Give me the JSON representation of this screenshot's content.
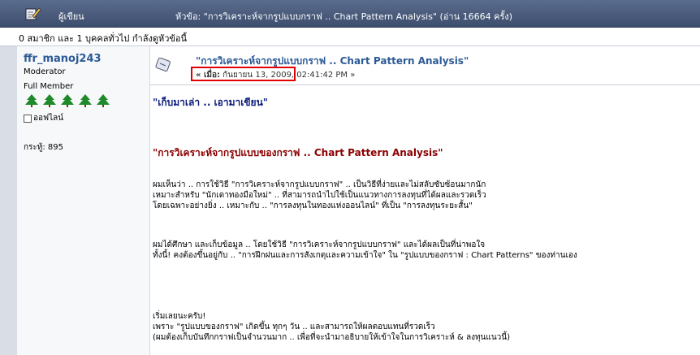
{
  "header": {
    "author_column": "ผู้เขียน",
    "topic": "หัวข้อ: \"การวิเคราะห์จากรูปแบบกราฟ .. Chart Pattern Analysis\"  (อ่าน 16664 ครั้ง)",
    "icon": "edit-icon"
  },
  "viewers": {
    "text": "0 สมาชิก และ 1 บุคคลทั่วไป กำลังดูหัวข้อนี้"
  },
  "poster": {
    "name": "ffr_manoj243",
    "role": "Moderator",
    "rank": "Full Member",
    "stars_icon": "tree-icon",
    "star_count": 5,
    "status": "ออฟไลน์",
    "posts": "กระทู้: 895"
  },
  "post": {
    "icon": "post-icon",
    "title": "\"การวิเคราะห์จากรูปแบบกราฟ .. Chart Pattern Analysis\"",
    "date_prefix": "« เมื่อ:",
    "date": "กันยายน 13, 2009, 02:41:42 PM »",
    "quote": "\"เก็บมาเล่า .. เอามาเขียน\"",
    "heading": "\"การวิเคราะห์จากรูปแบบของกราฟ .. Chart Pattern Analysis\"",
    "paragraphs": [
      [
        "ผมเห็นว่า .. การใช้วิธี \"การวิเคราะห์จากรูปแบบกราฟ\" .. เป็นวิธีที่ง่ายและไม่สลับซับซ้อนมากนัก",
        "เหมาะสำหรับ \"นักเดาทองมือใหม่\" .. ที่สามารถนำไปใช้เป็นแนวทางการลงทุนที่ได้ผลและรวดเร็ว",
        "โดยเฉพาะอย่างยิ่ง .. เหมาะกับ .. \"การลงทุนในทองแห่งออนไลน์\" ที่เป็น \"การลงทุนระยะสั้น\""
      ],
      [
        "ผมได้ศึกษา และเก็บข้อมูล .. โดยใช้วิธี \"การวิเคราะห์จากรูปแบบกราฟ\" และได้ผลเป็นที่น่าพอใจ",
        "ทั้งนี้!  คงต้องขึ้นอยู่กับ .. \"การฝึกฝนและการสังเกตุและความเข้าใจ\" ใน \"รูปแบบของกราฟ : Chart Patterns\" ของท่านเอง"
      ],
      [
        "เริ่มเลยนะครับ!",
        "เพราะ \"รูปแบบของกราฟ\" เกิดขึ้น ทุกๆ วัน .. และสามารถให้ผลตอบแทนที่รวดเร็ว",
        "(ผมต้องเก็บบันทึกกราฟเป็นจำนวนมาก .. เพื่อที่จะนำมาอธิบายให้เข้าใจในการวิเคราะห์ & ลงทุนแนวนี้)"
      ]
    ]
  }
}
